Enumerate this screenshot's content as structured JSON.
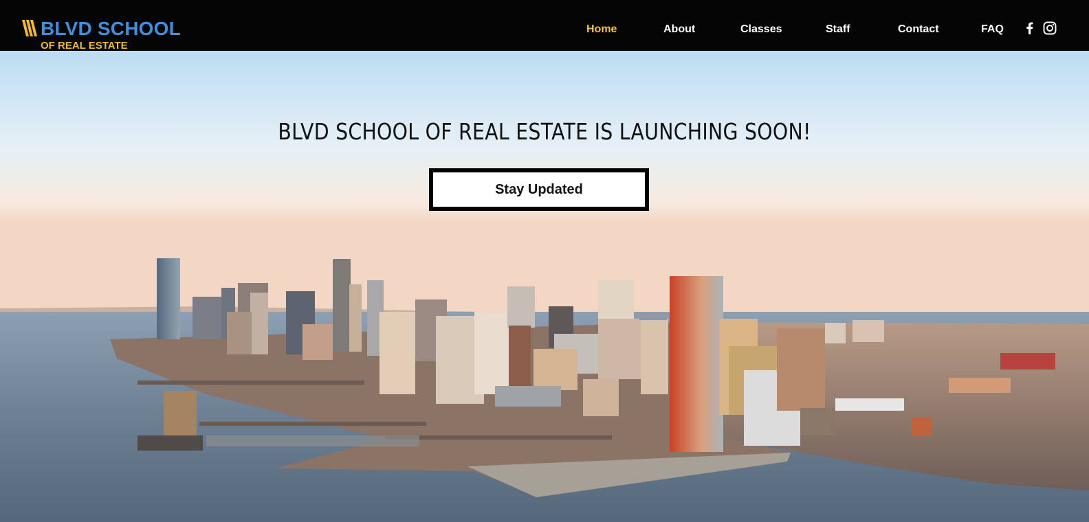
{
  "brand": {
    "title": "BLVD SCHOOL",
    "subtitle": "OF REAL ESTATE",
    "title_color": "#3d8fe0",
    "subtitle_color": "#f5b921"
  },
  "nav": {
    "items": [
      {
        "label": "Home",
        "active": true
      },
      {
        "label": "About",
        "active": false
      },
      {
        "label": "Classes",
        "active": false
      },
      {
        "label": "Staff",
        "active": false
      },
      {
        "label": "Contact",
        "active": false
      },
      {
        "label": "FAQ",
        "active": false
      }
    ],
    "active_color": "#f5c32c",
    "social_icons": [
      "facebook-icon",
      "instagram-icon"
    ]
  },
  "hero": {
    "headline": "BLVD SCHOOL OF REAL ESTATE IS LAUNCHING SOON!",
    "cta_label": "Stay Updated",
    "background": "city-skyline-waterfront-photo"
  }
}
